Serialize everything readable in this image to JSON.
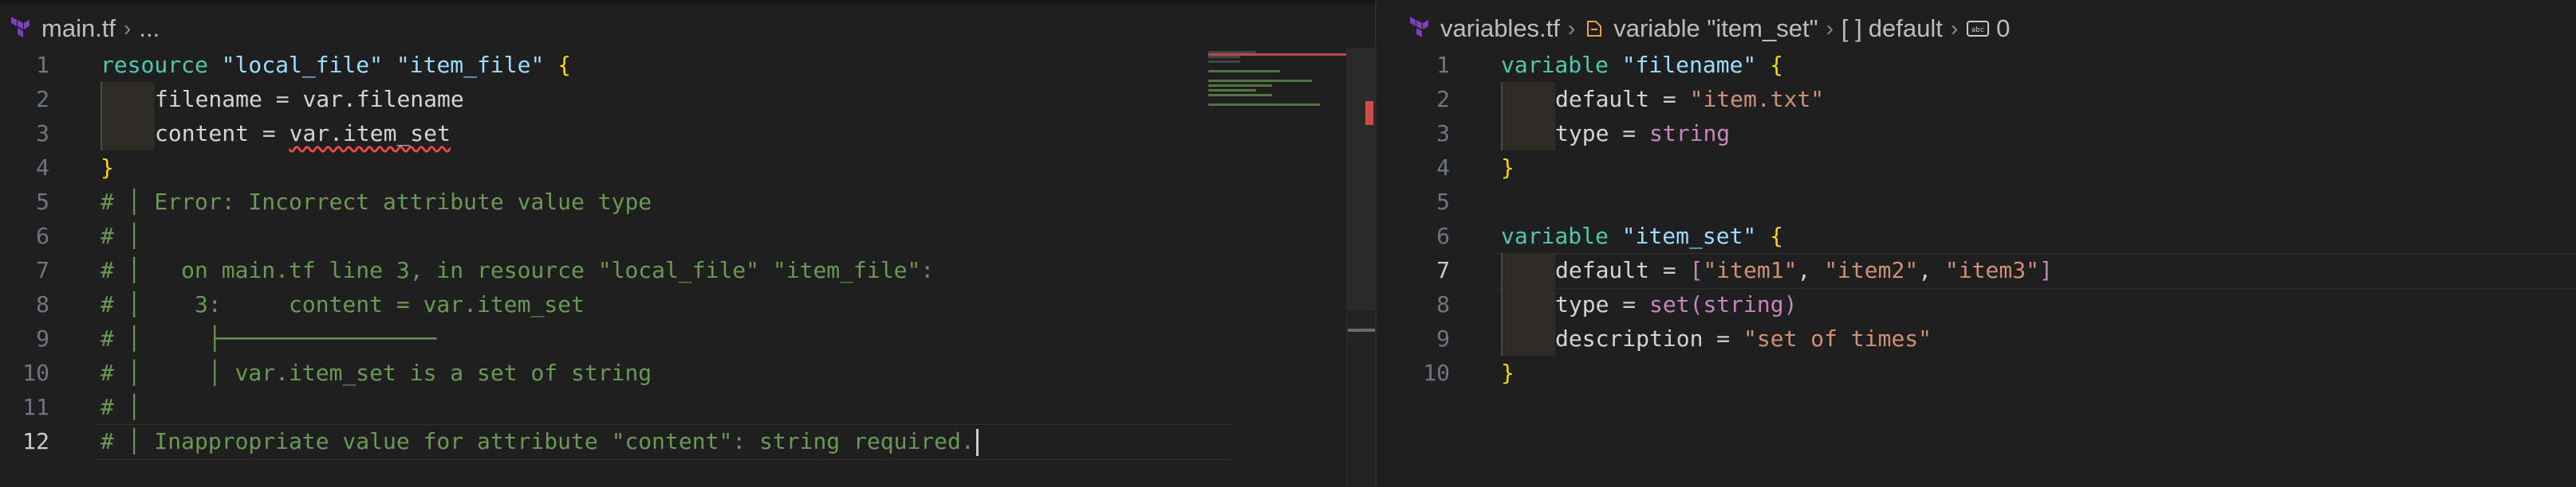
{
  "left_pane": {
    "breadcrumb": {
      "file": "main.tf",
      "more": "..."
    },
    "active_line": 12,
    "lines": [
      {
        "n": "1",
        "parts": [
          {
            "t": "resource",
            "c": "kw"
          },
          {
            "t": " "
          },
          {
            "t": "\"local_file\"",
            "c": "str"
          },
          {
            "t": " "
          },
          {
            "t": "\"item_file\"",
            "c": "str"
          },
          {
            "t": " "
          },
          {
            "t": "{",
            "c": "brace"
          }
        ]
      },
      {
        "n": "2",
        "indent": 1,
        "parts": [
          {
            "t": "filename",
            "c": "attr"
          },
          {
            "t": " = "
          },
          {
            "t": "var.filename",
            "c": "attr"
          }
        ]
      },
      {
        "n": "3",
        "indent": 1,
        "parts": [
          {
            "t": "content",
            "c": "attr"
          },
          {
            "t": " = "
          },
          {
            "t": "var.item_set",
            "c": "attr squiggle"
          }
        ]
      },
      {
        "n": "4",
        "parts": [
          {
            "t": "}",
            "c": "brace"
          }
        ]
      },
      {
        "n": "5",
        "parts": [
          {
            "t": "# │ Error: Incorrect attribute value type",
            "c": "cm"
          }
        ]
      },
      {
        "n": "6",
        "parts": [
          {
            "t": "# │",
            "c": "cm"
          }
        ]
      },
      {
        "n": "7",
        "parts": [
          {
            "t": "# │   on main.tf line 3, in resource \"local_file\" \"item_file\":",
            "c": "cm"
          }
        ]
      },
      {
        "n": "8",
        "parts": [
          {
            "t": "# │    3:     content = var.item_set",
            "c": "cm"
          }
        ]
      },
      {
        "n": "9",
        "parts": [
          {
            "t": "# │     ├────────────────",
            "c": "cm"
          }
        ]
      },
      {
        "n": "10",
        "parts": [
          {
            "t": "# │     │ var.item_set is a set of string",
            "c": "cm"
          }
        ]
      },
      {
        "n": "11",
        "parts": [
          {
            "t": "# │",
            "c": "cm"
          }
        ]
      },
      {
        "n": "12",
        "cursor": true,
        "parts": [
          {
            "t": "# │ Inappropriate value for attribute \"content\": string required.",
            "c": "cm"
          }
        ]
      }
    ]
  },
  "right_pane": {
    "breadcrumb": {
      "file": "variables.tf",
      "symbol": "variable \"item_set\"",
      "property": "default",
      "index": "0"
    },
    "active_line": 7,
    "lines": [
      {
        "n": "1",
        "parts": [
          {
            "t": "variable",
            "c": "kw"
          },
          {
            "t": " "
          },
          {
            "t": "\"filename\"",
            "c": "str"
          },
          {
            "t": " "
          },
          {
            "t": "{",
            "c": "brace"
          }
        ]
      },
      {
        "n": "2",
        "indent": 1,
        "parts": [
          {
            "t": "default",
            "c": "attr"
          },
          {
            "t": " = "
          },
          {
            "t": "\"item.txt\"",
            "c": "str2"
          }
        ]
      },
      {
        "n": "3",
        "indent": 1,
        "parts": [
          {
            "t": "type",
            "c": "attr"
          },
          {
            "t": " = "
          },
          {
            "t": "string",
            "c": "type"
          }
        ]
      },
      {
        "n": "4",
        "parts": [
          {
            "t": "}",
            "c": "brace"
          }
        ]
      },
      {
        "n": "5",
        "parts": []
      },
      {
        "n": "6",
        "parts": [
          {
            "t": "variable",
            "c": "kw"
          },
          {
            "t": " "
          },
          {
            "t": "\"item_set\"",
            "c": "str"
          },
          {
            "t": " "
          },
          {
            "t": "{",
            "c": "brace"
          }
        ]
      },
      {
        "n": "7",
        "indent": 1,
        "parts": [
          {
            "t": "default",
            "c": "attr"
          },
          {
            "t": " = "
          },
          {
            "t": "[",
            "c": "type"
          },
          {
            "t": "\"item1\"",
            "c": "str2"
          },
          {
            "t": ", "
          },
          {
            "t": "\"item2\"",
            "c": "str2"
          },
          {
            "t": ", "
          },
          {
            "t": "\"item3\"",
            "c": "str2"
          },
          {
            "t": "]",
            "c": "type"
          }
        ]
      },
      {
        "n": "8",
        "indent": 1,
        "parts": [
          {
            "t": "type",
            "c": "attr"
          },
          {
            "t": " = "
          },
          {
            "t": "set(string)",
            "c": "type"
          }
        ]
      },
      {
        "n": "9",
        "indent": 1,
        "parts": [
          {
            "t": "description",
            "c": "attr"
          },
          {
            "t": " = "
          },
          {
            "t": "\"set of times\"",
            "c": "str2"
          }
        ]
      },
      {
        "n": "10",
        "parts": [
          {
            "t": "}",
            "c": "brace"
          }
        ]
      }
    ]
  },
  "icons": {
    "file_icon": "terraform-icon",
    "symbol_icon": "variable-symbol-icon",
    "array_icon": "array-brackets-icon",
    "index_icon": "string-index-icon"
  },
  "colors": {
    "error": "#f14c4c",
    "comment": "#6a9955",
    "keyword": "#4ec9b0"
  }
}
